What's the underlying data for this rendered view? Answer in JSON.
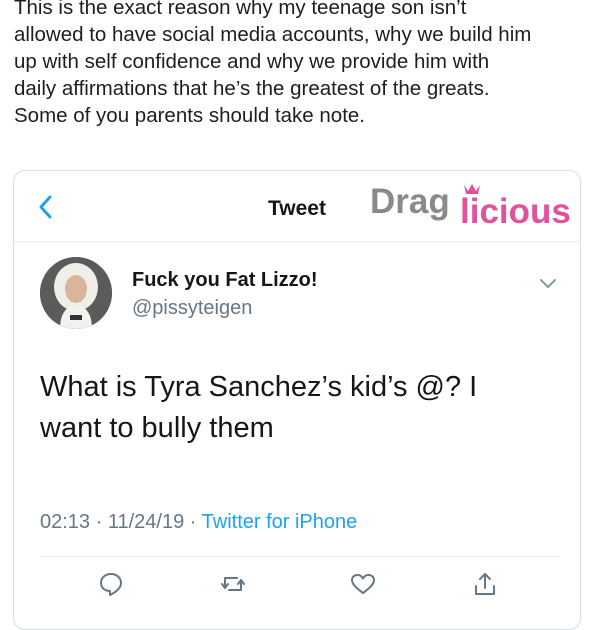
{
  "caption": {
    "lines": [
      "This is the exact reason why my teenage son isn’t",
      "allowed to have social media accounts, why we build him",
      "up with self confidence and why we provide him with",
      "daily affirmations that he’s the greatest of the greats.",
      "Some of you parents should take note."
    ]
  },
  "header": {
    "title": "Tweet",
    "watermark": "Draglicious"
  },
  "user": {
    "name": "Fuck you Fat Lizzo!",
    "handle": "@pissyteigen"
  },
  "tweet": {
    "lines": [
      "What is Tyra Sanchez’s kid’s @? I",
      "want to bully them"
    ],
    "time": "02:13",
    "date": "11/24/19",
    "source": "Twitter for iPhone",
    "separator": " · "
  },
  "icons": {
    "back": "chevron-left-icon",
    "more": "chevron-down-icon",
    "reply": "comment-icon",
    "retweet": "retweet-icon",
    "like": "heart-icon",
    "share": "share-icon"
  },
  "colors": {
    "accent": "#1da1f2",
    "muted": "#657786",
    "watermark_pink": "#e0529c",
    "watermark_gray": "#7a7a7a"
  }
}
